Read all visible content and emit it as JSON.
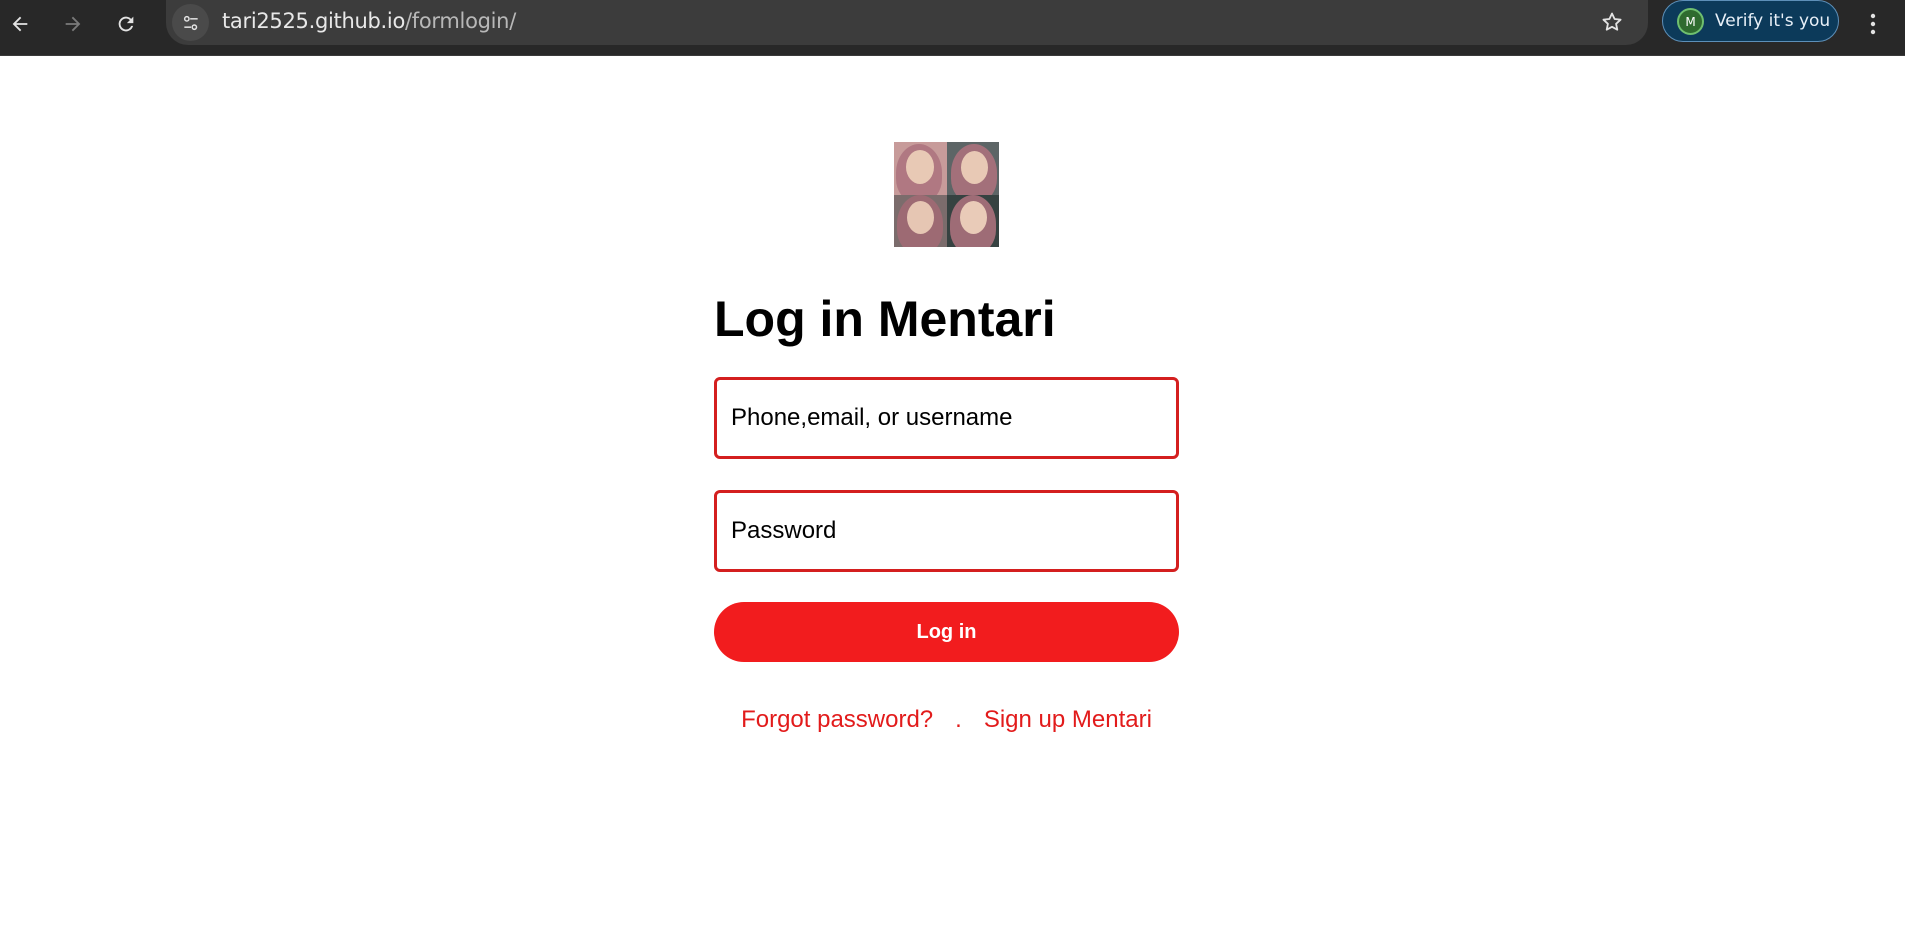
{
  "browser": {
    "url_host": "tari2525.github.io",
    "url_path": "/formlogin/",
    "back_icon": "arrow-left-icon",
    "forward_icon": "arrow-right-icon",
    "reload_icon": "reload-icon",
    "site_info_icon": "tune-icon",
    "bookmark_icon": "star-icon",
    "verify_chip": {
      "avatar_letter": "M",
      "label": "Verify it's you"
    },
    "menu_icon": "kebab-menu-icon"
  },
  "login": {
    "title": "Log in Mentari",
    "username_placeholder": "Phone,email, or username",
    "password_placeholder": "Password",
    "login_button": "Log in",
    "forgot_password": "Forgot password?",
    "separator": ".",
    "sign_up": "Sign up Mentari"
  },
  "colors": {
    "toolbar_bg": "#282828",
    "accent_red": "#f21c1e",
    "field_border": "#d41f1f",
    "link_red": "#e21b1b"
  }
}
